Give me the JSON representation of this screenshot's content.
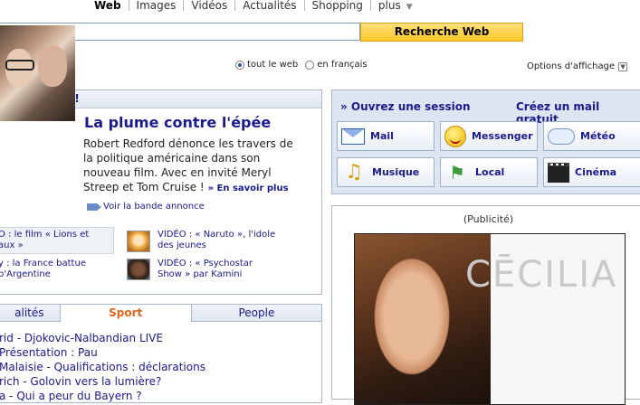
{
  "search": {
    "tabs": [
      "Web",
      "Images",
      "Vidéos",
      "Actualités",
      "Shopping",
      "plus"
    ],
    "active_tab": "Web",
    "query": "",
    "button_label": "Recherche Web",
    "radio_all": "tout le web",
    "radio_fr": "en français",
    "radio_selected": "tout le web",
    "display_options": "Options d'affichage"
  },
  "news": {
    "header": "ui sur Yahoo!",
    "headline": "La plume contre l'épée",
    "summary": "Robert Redford dénonce les travers de la politique américaine dans son nouveau film. Avec en invité Meryl Streep et Tom Cruise !",
    "more_link": "» En savoir plus",
    "trailer_link": "Voir la bande annonce",
    "mini_items": [
      {
        "line1": "O : le film « Lions et",
        "line2": "aux »"
      },
      {
        "line1": "y : la France battue",
        "line2": "p'Argentine"
      }
    ],
    "videos": [
      {
        "line1": "VIDÉO : « Naruto », l'idole",
        "line2": "des jeunes"
      },
      {
        "line1": "VIDÉO : « Psychostar",
        "line2": "Show » par Kamini"
      }
    ]
  },
  "sport": {
    "tabs": [
      "alités",
      "Sport",
      "People"
    ],
    "active_tab": "Sport",
    "items": [
      "rid - Djokovic-Nalbandian LIVE",
      " Présentation : Pau",
      "Malaisie - Qualifications : déclarations",
      "rich - Golovin vers la lumière?",
      "a - Qui a peur du Bayern ?"
    ]
  },
  "services": {
    "session_link": "» Ouvrez une session",
    "create_mail_link": "Créez un mail gratuit",
    "items": [
      {
        "label": "Mail",
        "icon": "mail-icon"
      },
      {
        "label": "Messenger",
        "icon": "messenger-smiley-icon"
      },
      {
        "label": "Météo",
        "icon": "weather-cloud-icon"
      },
      {
        "label": "Musique",
        "icon": "music-note-icon"
      },
      {
        "label": "Local",
        "icon": "signpost-icon"
      },
      {
        "label": "Cinéma",
        "icon": "clapperboard-icon"
      }
    ]
  },
  "ad": {
    "label": "(Publicité)",
    "brand": "CĒCILIA"
  },
  "colors": {
    "link": "#1a1a8c",
    "search_button": "#ffc928",
    "active_sport_tab": "#e1661b"
  }
}
